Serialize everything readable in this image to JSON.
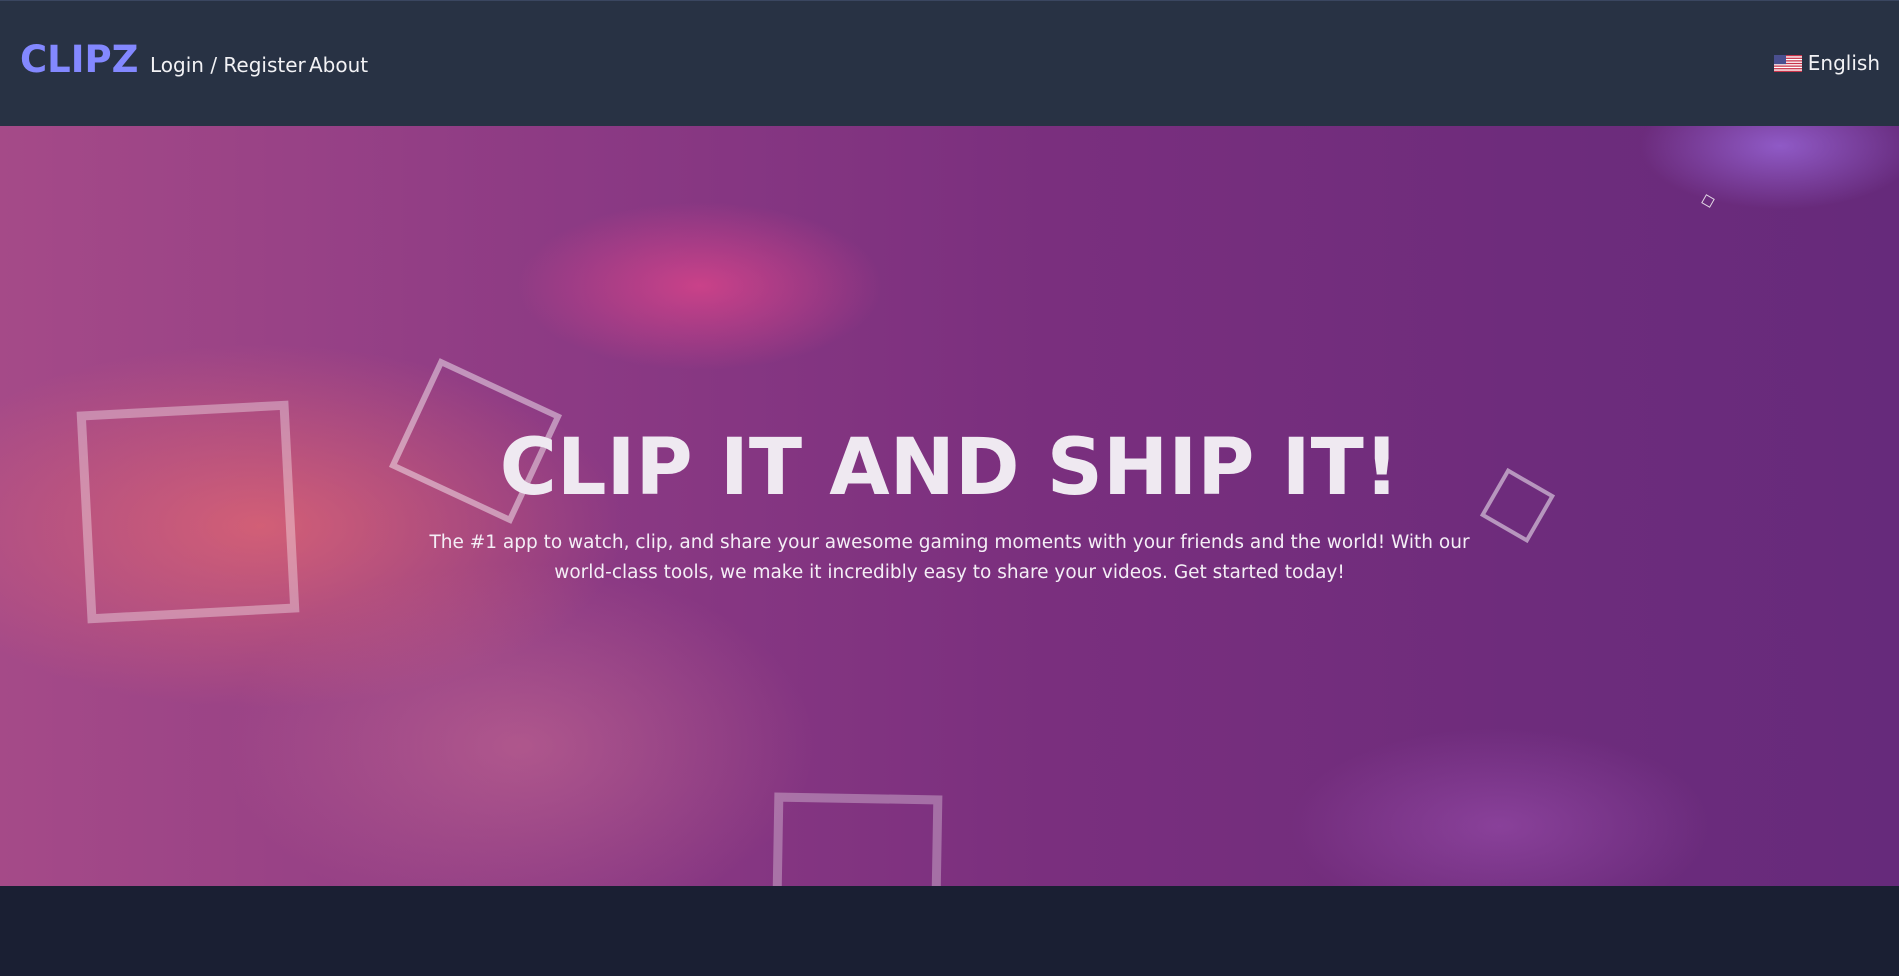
{
  "navbar": {
    "brand": "CLIPZ",
    "links": [
      {
        "label": "Login / Register"
      },
      {
        "label": "About"
      }
    ],
    "language": {
      "label": "English",
      "icon": "us-flag-icon"
    }
  },
  "hero": {
    "title": "CLIP IT AND SHIP IT!",
    "subtitle": "The #1 app to watch, clip, and share your awesome gaming moments with your friends and the world! With our world-class tools, we make it incredibly easy to share your videos. Get started today!"
  },
  "colors": {
    "navbar_bg": "#283244",
    "brand": "#8388ff",
    "hero_overlay": "#7a2f7e",
    "page_bg": "#1a1f33"
  }
}
